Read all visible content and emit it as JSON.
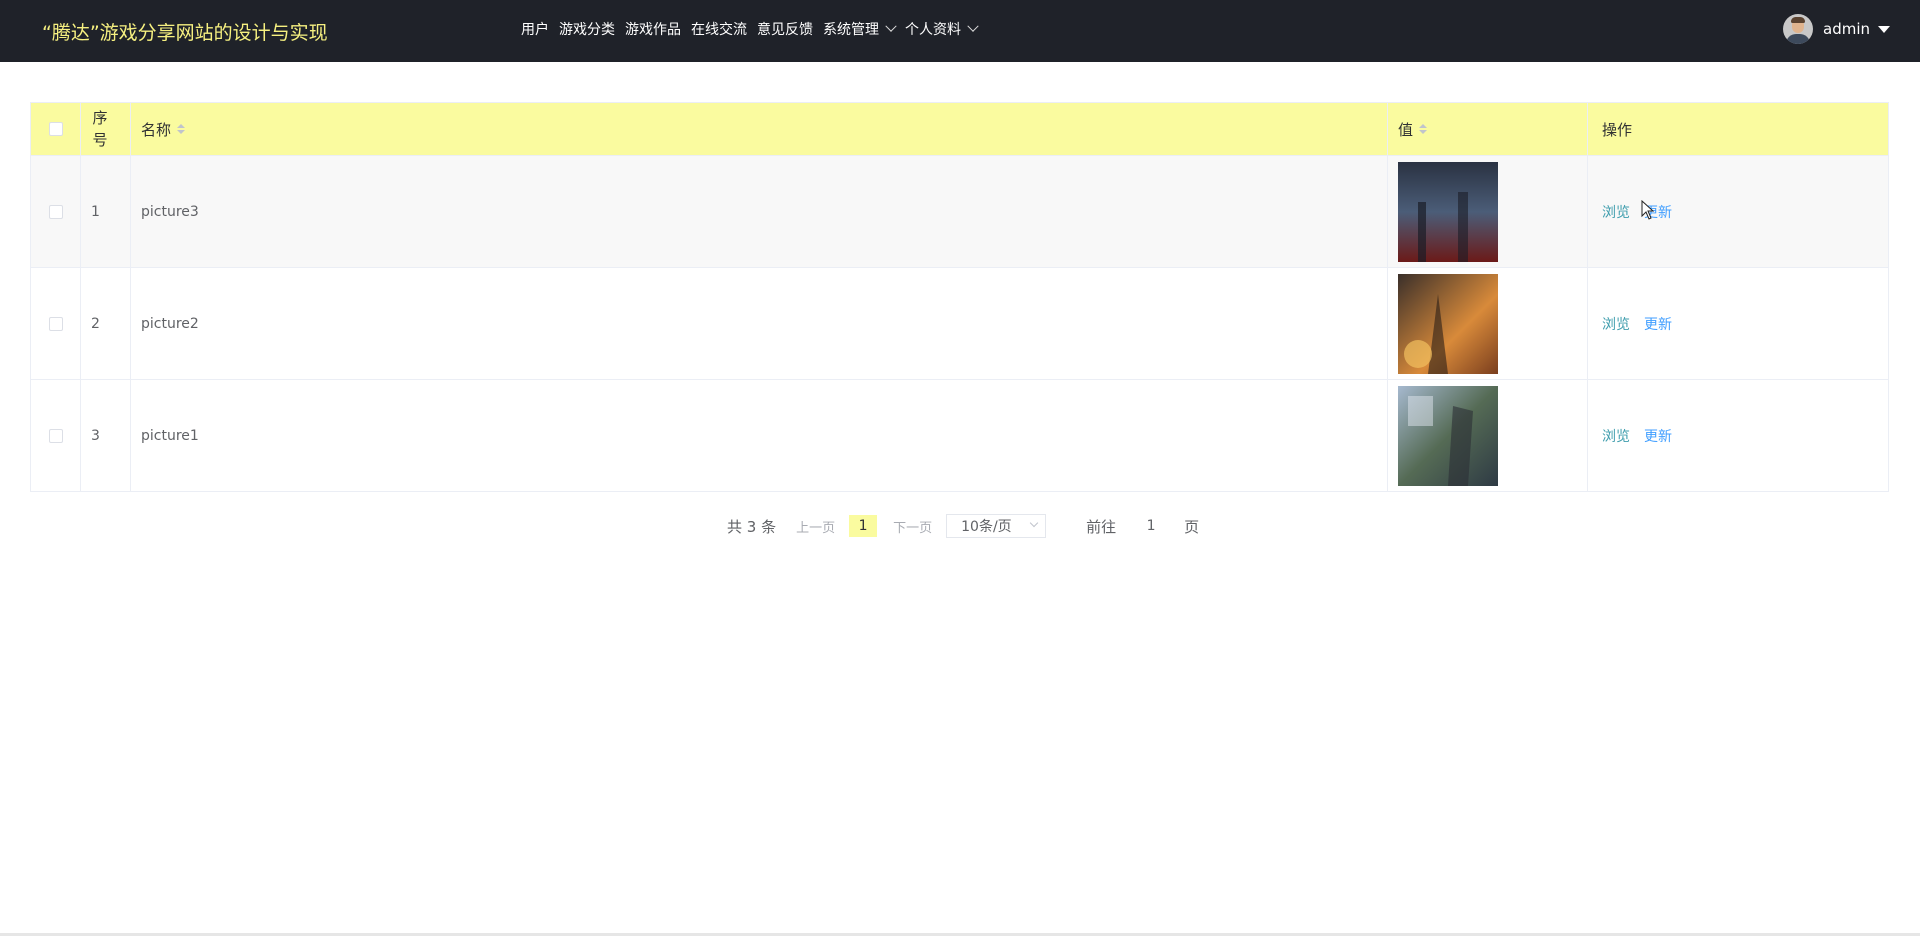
{
  "header": {
    "site_title": "“腾达”游戏分享网站的设计与实现",
    "nav": [
      {
        "label": "用户",
        "dropdown": false
      },
      {
        "label": "游戏分类",
        "dropdown": false
      },
      {
        "label": "游戏作品",
        "dropdown": false
      },
      {
        "label": "在线交流",
        "dropdown": false
      },
      {
        "label": "意见反馈",
        "dropdown": false
      },
      {
        "label": "系统管理",
        "dropdown": true
      },
      {
        "label": "个人资料",
        "dropdown": true
      }
    ],
    "user": {
      "name": "admin"
    }
  },
  "table": {
    "columns": {
      "index": "序号",
      "name": "名称",
      "value": "值",
      "actions": "操作"
    },
    "rows": [
      {
        "index": "1",
        "name": "picture3",
        "view": "浏览",
        "update": "更新",
        "thumb": [
          "#2a3242",
          "#4b5d78",
          "#6b1a18"
        ]
      },
      {
        "index": "2",
        "name": "picture2",
        "view": "浏览",
        "update": "更新",
        "thumb": [
          "#3a2f2a",
          "#d88a3a",
          "#7a3e1e"
        ]
      },
      {
        "index": "3",
        "name": "picture1",
        "view": "浏览",
        "update": "更新",
        "thumb": [
          "#a6b9cf",
          "#556b55",
          "#2e3a44"
        ]
      }
    ]
  },
  "pagination": {
    "total": "共 3 条",
    "prev": "上一页",
    "current_page": "1",
    "next": "下一页",
    "page_size": "10条/页",
    "goto_label": "前往",
    "goto_value": "1",
    "page_suffix": "页"
  },
  "colors": {
    "topbar": "#1f2229",
    "title": "#f6f080",
    "header_row": "#fafb9f",
    "link": "#409eae"
  }
}
